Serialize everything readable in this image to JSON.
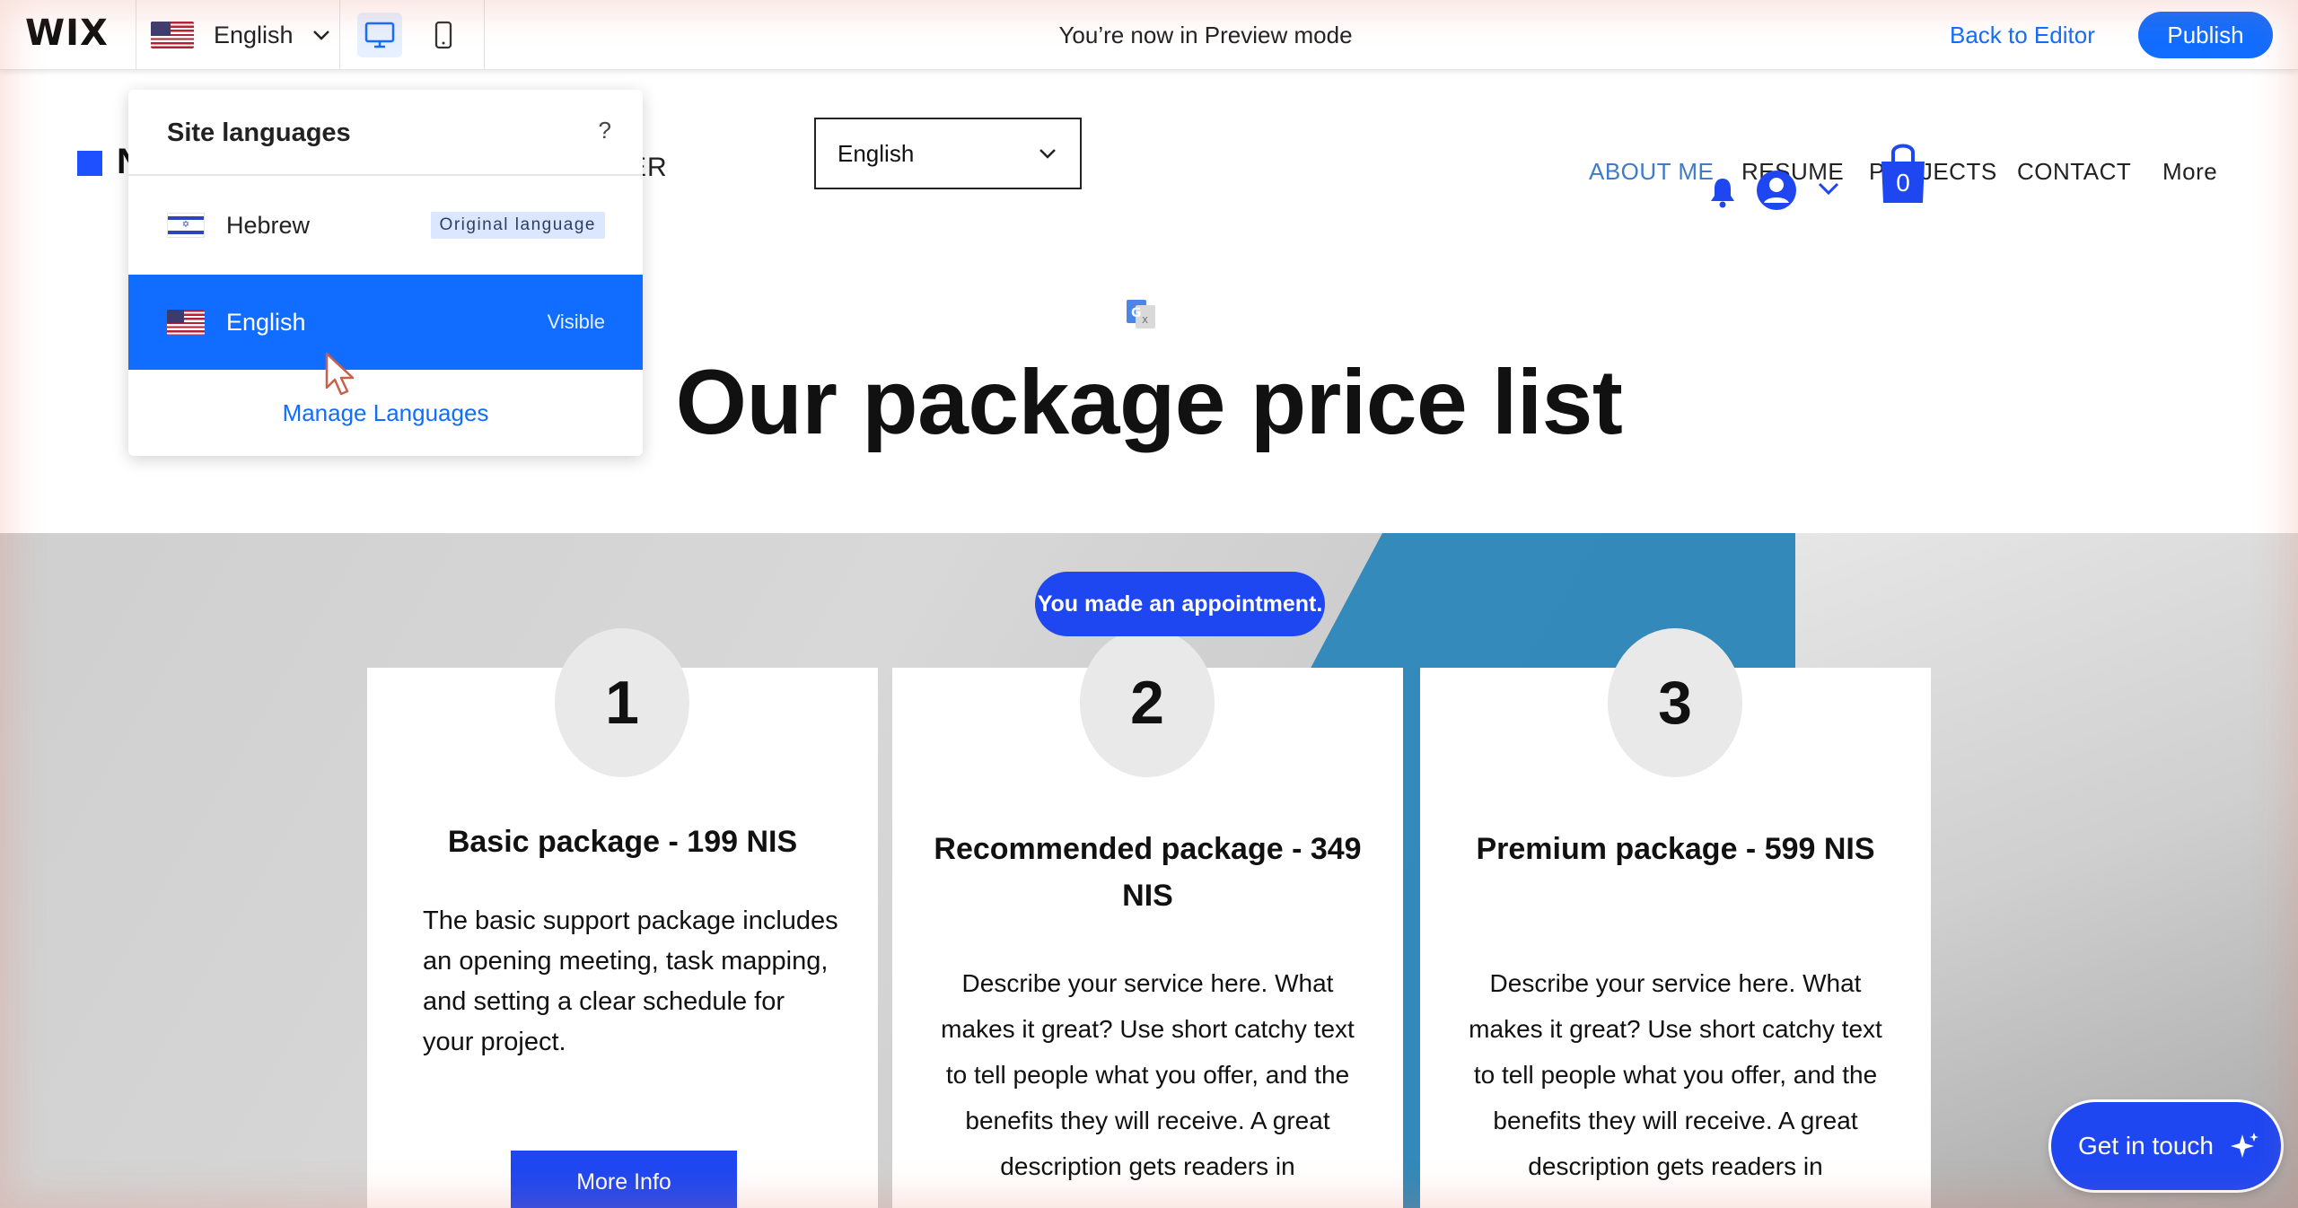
{
  "topbar": {
    "logo": "WIX",
    "language_label": "English",
    "preview_message": "You’re now in Preview mode",
    "back_to_editor": "Back to Editor",
    "publish": "Publish",
    "devices": [
      "desktop-icon",
      "mobile-icon"
    ]
  },
  "site_header": {
    "logo_letter": "N",
    "logo_tail": "ER",
    "language_select": "English",
    "nav": [
      "ABOUT ME",
      "RESUME",
      "PROJECTS",
      "CONTACT",
      "More"
    ],
    "active_nav": "ABOUT ME",
    "cart_count": "0"
  },
  "language_popover": {
    "title": "Site languages",
    "help": "?",
    "languages": [
      {
        "name": "Hebrew",
        "badge": "Original language"
      },
      {
        "name": "English",
        "status": "Visible"
      }
    ],
    "manage_link": "Manage Languages"
  },
  "page": {
    "title": "Our package price list",
    "appointment_pill": "You made an appointment."
  },
  "packages": [
    {
      "number": "1",
      "title": "Basic package - 199 NIS",
      "description": "The basic support package includes an opening meeting, task mapping, and setting a clear schedule for your project.",
      "button": "More Info"
    },
    {
      "number": "2",
      "title": "Recommended package - 349 NIS",
      "description": "Describe your service here. What makes it great? Use short catchy text to tell people what you offer, and the benefits they will receive. A great description gets readers in"
    },
    {
      "number": "3",
      "title": "Premium package - 599 NIS",
      "description": "Describe your service here. What makes it great? Use short catchy text to tell people what you offer, and the benefits they will receive. A great description gets readers in"
    }
  ],
  "get_in_touch": "Get in touch",
  "colors": {
    "accent": "#116dff",
    "site_blue": "#1e47f2",
    "stripe_blue": "#2b86b8"
  }
}
